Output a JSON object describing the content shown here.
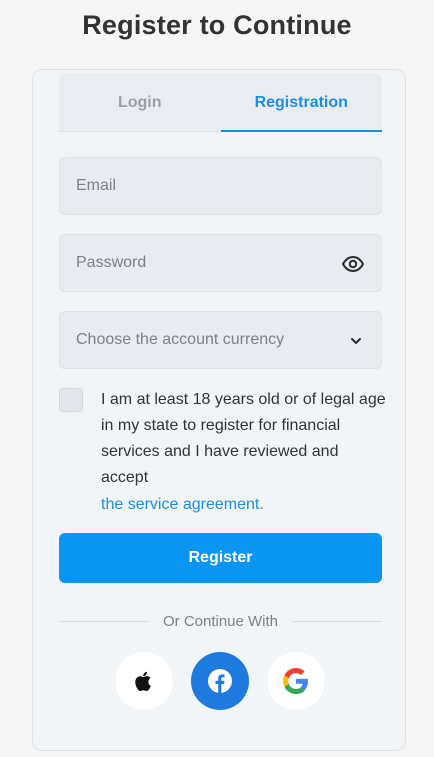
{
  "header": {
    "title": "Register to Continue"
  },
  "tabs": [
    {
      "label": "Login",
      "active": false
    },
    {
      "label": "Registration",
      "active": true
    }
  ],
  "form": {
    "email_placeholder": "Email",
    "email_value": "",
    "password_placeholder": "Password",
    "password_value": "",
    "currency_placeholder": "Choose the account currency",
    "agreement_text": "I am at least 18 years old or of legal age in my state to register for financial services and I have reviewed and accept",
    "agreement_link": "the service agreement.",
    "agreement_checked": false,
    "register_label": "Register"
  },
  "social": {
    "divider_label": "Or Continue With",
    "providers": [
      {
        "name": "apple",
        "icon": "apple-icon"
      },
      {
        "name": "facebook",
        "icon": "facebook-icon"
      },
      {
        "name": "google",
        "icon": "google-icon"
      }
    ]
  },
  "colors": {
    "accent": "#0a95f3",
    "link": "#1a8fe3",
    "facebook": "#1f7ae0",
    "background": "#f6f6f6",
    "card": "#f2f5f8"
  }
}
